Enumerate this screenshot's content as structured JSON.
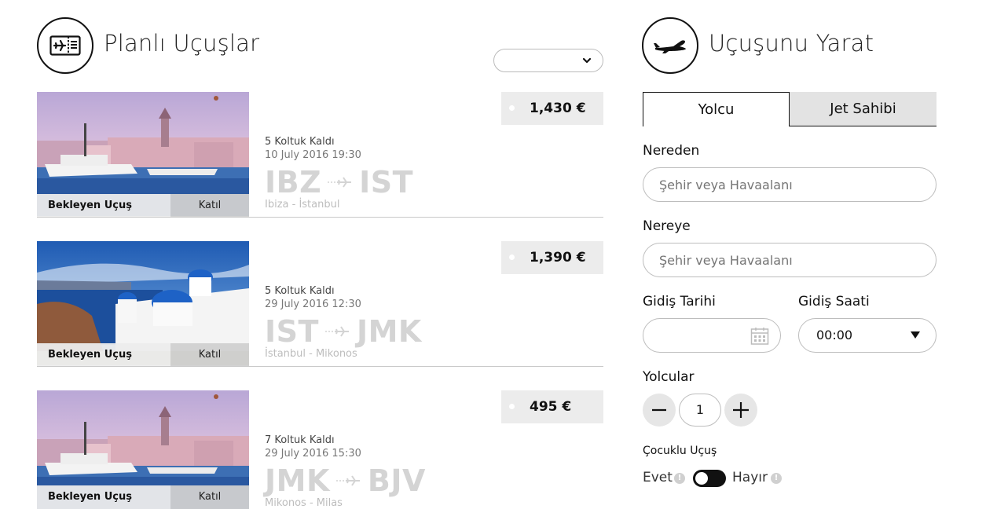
{
  "left_panel": {
    "title": "Planlı Uçuşlar",
    "header_icon": "ticket-icon",
    "sort_select": {
      "value": ""
    }
  },
  "flights": [
    {
      "image": "istanbul-harbor-photo",
      "status": "Bekleyen Uçuş",
      "join_label": "Katıl",
      "seats": "5 Koltuk Kaldı",
      "datetime": "10 July 2016 19:30",
      "from": "IBZ",
      "to": "IST",
      "cities": "Ibiza - İstanbul",
      "price": "1,430 €"
    },
    {
      "image": "santorini-church-photo",
      "status": "Bekleyen Uçuş",
      "join_label": "Katıl",
      "seats": "5 Koltuk Kaldı",
      "datetime": "29 July 2016 12:30",
      "from": "IST",
      "to": "JMK",
      "cities": "İstanbul - Mikonos",
      "price": "1,390 €"
    },
    {
      "image": "istanbul-harbor-photo",
      "status": "Bekleyen Uçuş",
      "join_label": "Katıl",
      "seats": "7 Koltuk Kaldı",
      "datetime": "29 July 2016 15:30",
      "from": "JMK",
      "to": "BJV",
      "cities": "Mikonos - Milas",
      "price": "495 €"
    }
  ],
  "right_panel": {
    "title": "Uçuşunu Yarat",
    "header_icon": "airplane-icon",
    "tabs": [
      {
        "label": "Yolcu",
        "active": true
      },
      {
        "label": "Jet Sahibi",
        "active": false
      }
    ],
    "from_label": "Nereden",
    "from_placeholder": "Şehir veya Havaalanı",
    "to_label": "Nereye",
    "to_placeholder": "Şehir veya Havaalanı",
    "date_label": "Gidiş Tarihi",
    "date_value": "",
    "time_label": "Gidiş Saati",
    "time_value": "00:00",
    "passengers_label": "Yolcular",
    "passengers_value": "1",
    "child_flight_label": "Çocuklu Uçuş",
    "yes_label": "Evet",
    "no_label": "Hayır",
    "child_flight_selected": "Hayır"
  },
  "colors": {
    "accent_dark": "#111111",
    "route_code_gray": "#d4d4d4",
    "price_bg": "#ececec",
    "tab_idle_bg": "#e3e3e3"
  }
}
